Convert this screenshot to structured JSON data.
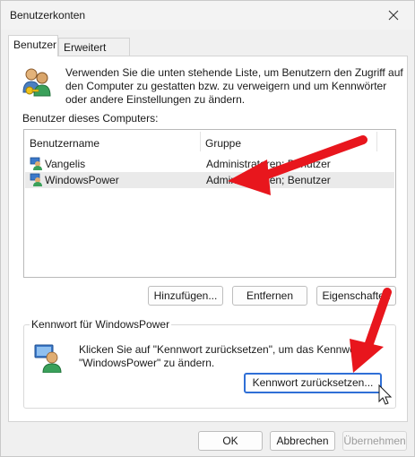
{
  "window": {
    "title": "Benutzerkonten"
  },
  "tabs": [
    {
      "label": "Benutzer",
      "active": true
    },
    {
      "label": "Erweitert",
      "active": false
    }
  ],
  "intro_text": "Verwenden Sie die unten stehende Liste, um Benutzern den Zugriff auf den Computer zu gestatten bzw. zu verweigern und um Kennwörter oder andere Einstellungen zu ändern.",
  "users_list": {
    "caption": "Benutzer dieses Computers:",
    "columns": [
      "Benutzername",
      "Gruppe"
    ],
    "rows": [
      {
        "name": "Vangelis",
        "group": "Administratoren; Benutzer",
        "selected": false
      },
      {
        "name": "WindowsPower",
        "group": "Administratoren; Benutzer",
        "selected": true
      }
    ]
  },
  "list_buttons": {
    "add": "Hinzufügen...",
    "remove": "Entfernen",
    "properties": "Eigenschaften"
  },
  "password_group": {
    "title": "Kennwort für WindowsPower",
    "text": "Klicken Sie auf \"Kennwort zurücksetzen\", um das Kennwort für \"WindowsPower\" zu ändern.",
    "reset_button": "Kennwort zurücksetzen..."
  },
  "footer": {
    "ok": "OK",
    "cancel": "Abbrechen",
    "apply": "Übernehmen"
  },
  "icons": [
    "close-icon",
    "users-icon",
    "user-icon",
    "password-user-icon",
    "mouse-cursor-icon",
    "red-arrow-icon"
  ],
  "colors": {
    "accent": "#2f6fd6",
    "annotation_arrow": "#e8161d"
  }
}
